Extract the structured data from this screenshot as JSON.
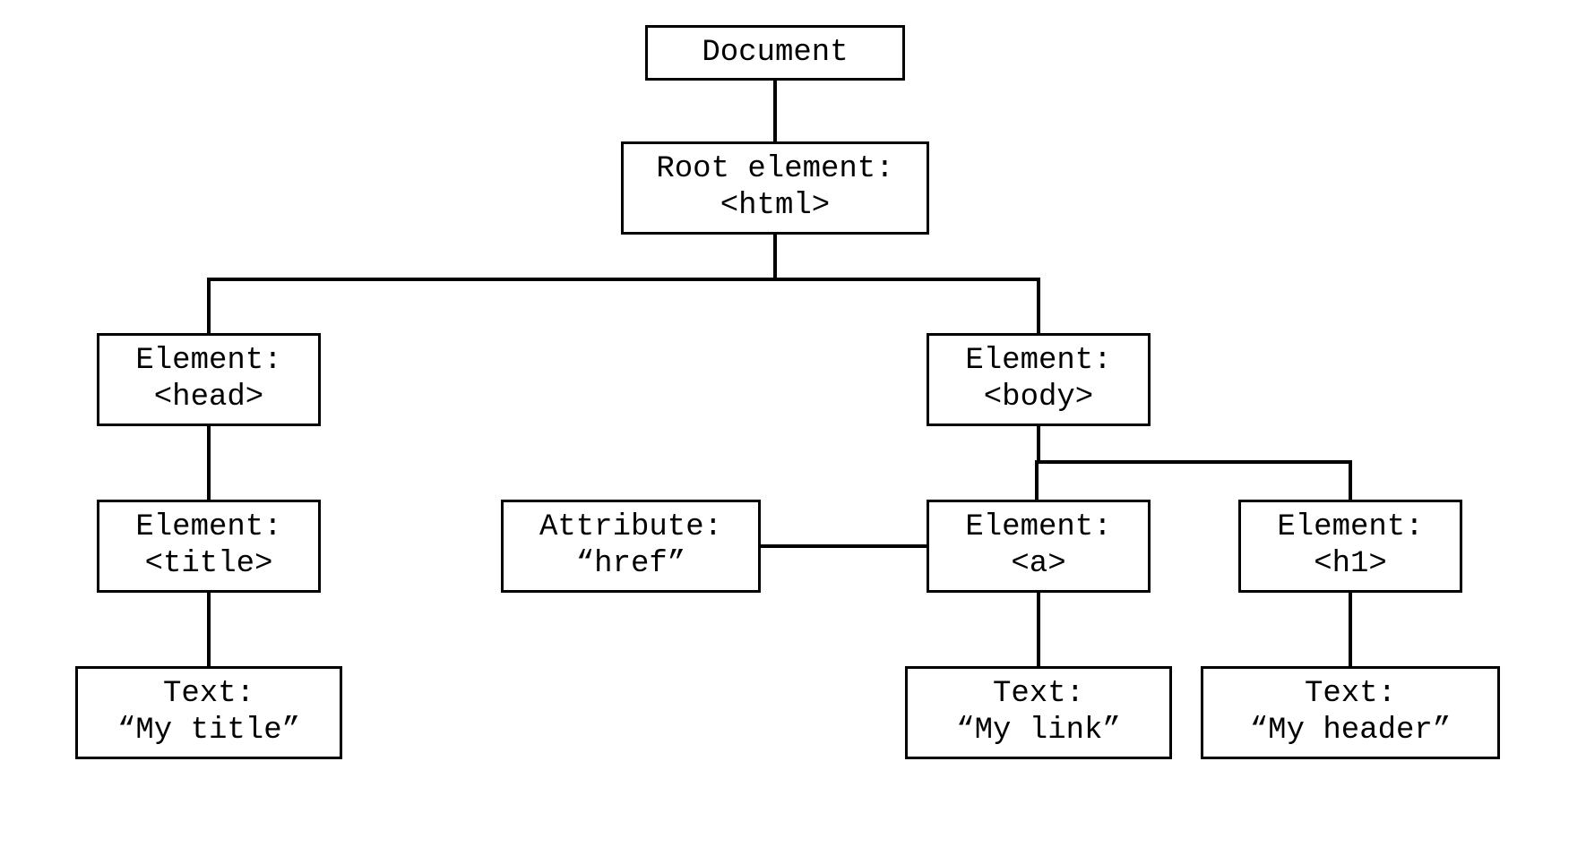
{
  "nodes": {
    "document": {
      "line1": "Document"
    },
    "root": {
      "line1": "Root element:",
      "line2": "<html>"
    },
    "head": {
      "line1": "Element:",
      "line2": "<head>"
    },
    "body": {
      "line1": "Element:",
      "line2": "<body>"
    },
    "title": {
      "line1": "Element:",
      "line2": "<title>"
    },
    "attr": {
      "line1": "Attribute:",
      "line2": "“href”"
    },
    "a": {
      "line1": "Element:",
      "line2": "<a>"
    },
    "h1": {
      "line1": "Element:",
      "line2": "<h1>"
    },
    "text_title": {
      "line1": "Text:",
      "line2": "“My title”"
    },
    "text_link": {
      "line1": "Text:",
      "line2": "“My link”"
    },
    "text_header": {
      "line1": "Text:",
      "line2": "“My header”"
    }
  }
}
